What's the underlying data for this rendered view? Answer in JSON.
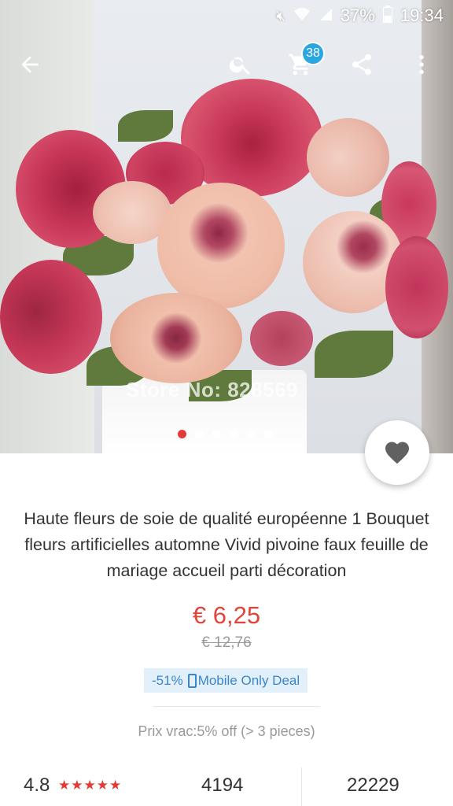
{
  "status_bar": {
    "battery": "37%",
    "time": "19:34"
  },
  "toolbar": {
    "cart_count": "38"
  },
  "hero": {
    "watermark": "Store No: 828569",
    "carousel": {
      "count": 6,
      "active_index": 0
    }
  },
  "product": {
    "title": "Haute fleurs de soie de qualité européenne 1 Bouquet fleurs artificielles automne Vivid pivoine faux feuille de mariage accueil parti décoration",
    "price": "€ 6,25",
    "old_price": "€ 12,76",
    "discount": "-51%",
    "deal_label": "Mobile Only Deal",
    "bulk_price": "Prix vrac:5% off (> 3 pieces)"
  },
  "stats": {
    "rating": "4.8",
    "stars": "★★★★★",
    "orders": "4194",
    "wishlist": "22229"
  },
  "colors": {
    "accent_red": "#e53935",
    "price_red": "#e0443a",
    "badge_blue": "#2aa6e0"
  }
}
